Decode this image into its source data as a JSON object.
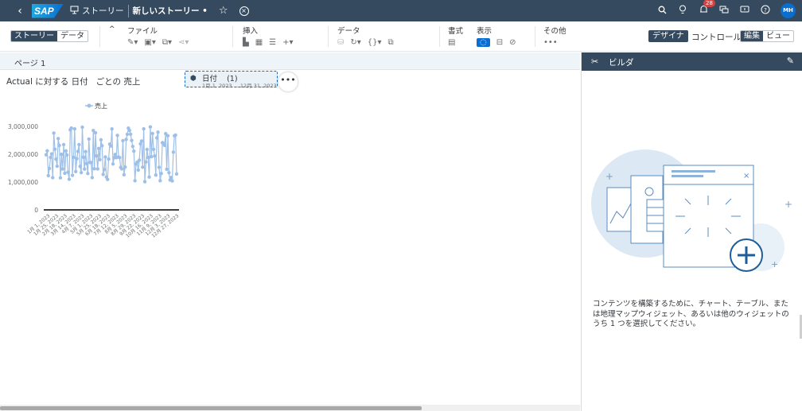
{
  "shell": {
    "back_glyph": "‹",
    "logo": "SAP",
    "story_label": "ストーリー",
    "doc_title": "新しいストーリー •",
    "notification_count": "28",
    "avatar_initials": "MH"
  },
  "toolbar": {
    "mode_story": "ストーリー",
    "mode_data": "データ",
    "group_file": "ファイル",
    "group_insert": "挿入",
    "group_data": "データ",
    "group_format": "書式",
    "group_view": "表示",
    "group_other": "その他",
    "other_glyph": "•••",
    "designer": "デザイナ",
    "control": "コントロール",
    "edit": "編集",
    "view": "ビュー"
  },
  "page": {
    "tab": "ページ 1"
  },
  "widget": {
    "title": "Actual に対する 日付   ごとの 売上",
    "filter_title": "日付    (1)",
    "filter_sub": "1月 1, 2023 ... 12月 31, 2023",
    "more": "•••"
  },
  "chart_data": {
    "type": "line",
    "series": [
      {
        "name": "売上",
        "color": "#9ec0e8"
      }
    ],
    "y_ticks": [
      "3,000,000",
      "2,000,000",
      "1,000,000",
      "0"
    ],
    "ylim": [
      0,
      3000000
    ],
    "x_ticks": [
      "1月 1, 2023",
      "1月 25, 2023",
      "2月 18, 2023",
      "3月 14, 2023",
      "4月 7, 2023",
      "5月 1, 2023",
      "5月 25, 2023",
      "6月 18, 2023",
      "7月 12, 2023",
      "8月 5, 2023",
      "8月 29, 2023",
      "9月 22, 2023",
      "10月 16, 2023",
      "11月 9, 2023",
      "12月 3, 2023",
      "12月 27, 2023"
    ],
    "legend_position": "top"
  },
  "builder": {
    "title": "ビルダ",
    "help_text": "コンテンツを構築するために、チャート、テーブル、または地理マップウィジェット、あるいは他のウィジェットのうち 1 つを選択してください。"
  }
}
